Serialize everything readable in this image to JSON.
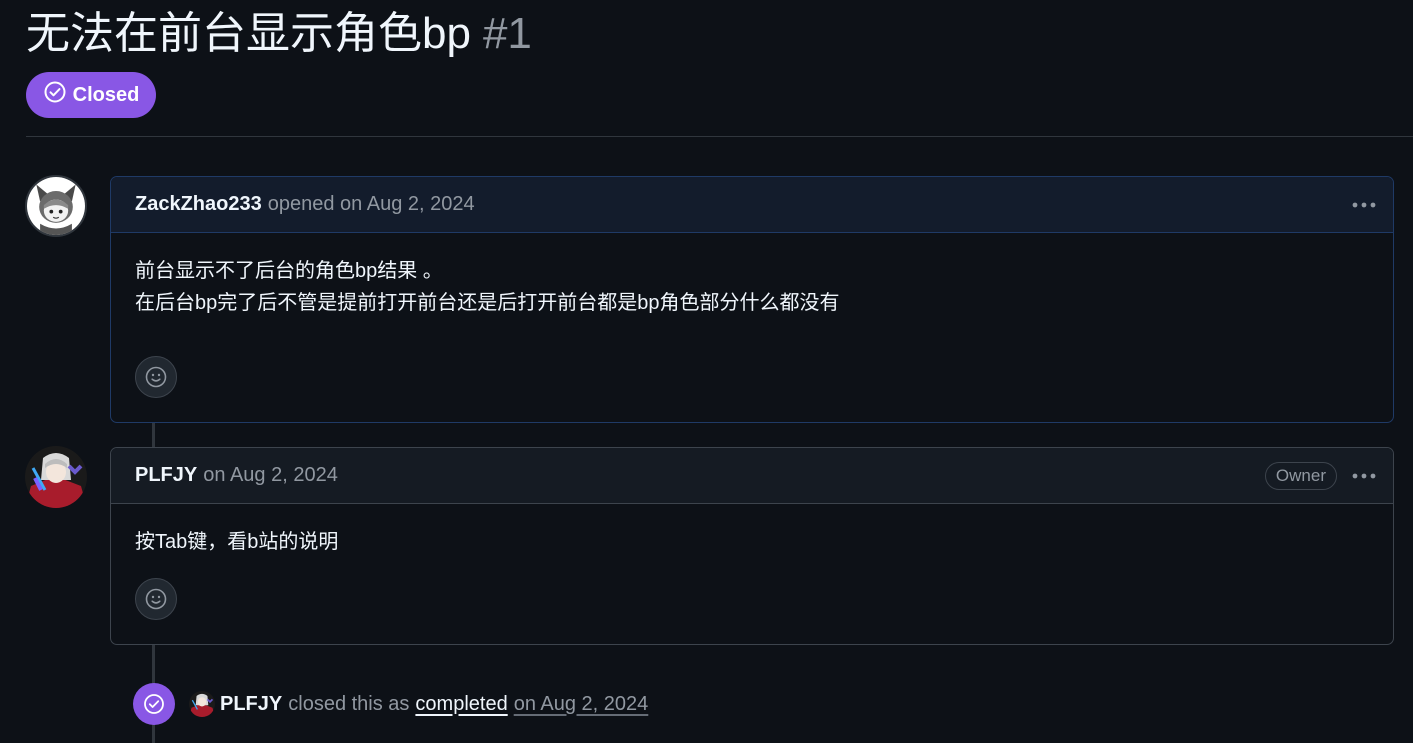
{
  "issue": {
    "title": "无法在前台显示角色bp",
    "number": "#1",
    "state": "Closed",
    "state_icon": "check-circle-icon",
    "state_color": "#8957e5"
  },
  "comments": [
    {
      "author": "ZackZhao233",
      "meta": "opened on Aug 2, 2024",
      "avatar": "wolf-girl-avatar",
      "body_lines": [
        "前台显示不了后台的角色bp结果 。",
        "在后台bp完了后不管是提前打开前台还是后打开前台都是bp角色部分什么都没有"
      ],
      "reaction_icon": "smiley-icon",
      "menu_icon": "kebab-horizontal-icon"
    },
    {
      "author": "PLFJY",
      "meta": "on Aug 2, 2024",
      "avatar": "plfjy-avatar",
      "badge": "Owner",
      "body_lines": [
        "按Tab键，看b站的说明"
      ],
      "reaction_icon": "smiley-icon",
      "menu_icon": "kebab-horizontal-icon"
    }
  ],
  "event": {
    "author": "PLFJY",
    "text": "closed this as",
    "link": "completed",
    "date": "on Aug 2, 2024",
    "icon": "check-circle-icon"
  },
  "colors": {
    "background": "#0d1117",
    "closed_purple": "#8957e5",
    "border": "#3d444d",
    "muted_text": "#9198a1"
  }
}
